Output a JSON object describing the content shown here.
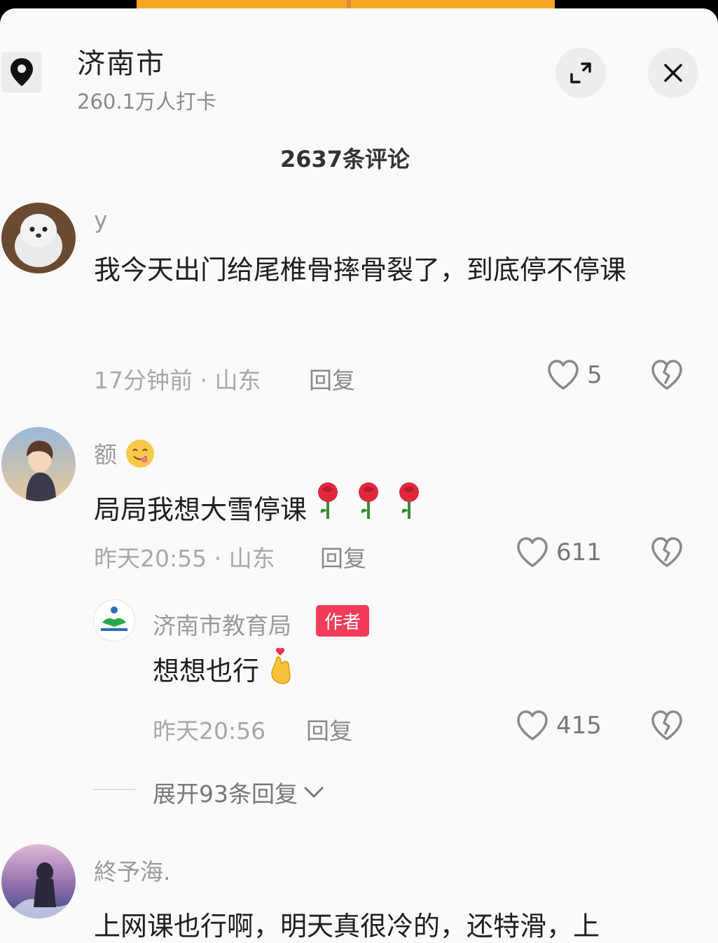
{
  "location": {
    "name": "济南市",
    "checkins": "260.1万人打卡"
  },
  "comment_count": "2637条评论",
  "comments": [
    {
      "username": "y",
      "text": "我今天出门给尾椎骨摔骨裂了，到底停不停课",
      "time_place": "17分钟前 · 山东",
      "reply_label": "回复",
      "likes": "5"
    },
    {
      "username": "额",
      "text": "局局我想大雪停课",
      "time_place": "昨天20:55 · 山东",
      "reply_label": "回复",
      "likes": "611",
      "reply": {
        "username": "济南市教育局",
        "badge": "作者",
        "text": "想想也行",
        "time": "昨天20:56",
        "reply_label": "回复",
        "likes": "415"
      },
      "expand_label": "展开93条回复"
    },
    {
      "username": "終予海.",
      "text": "上网课也行啊，明天真很冷的，还特滑，上"
    }
  ],
  "colors": {
    "badge": "#f23c5a",
    "video_accent": "#f5a623"
  },
  "icons": [
    "location-pin-icon",
    "expand-icon",
    "close-icon",
    "heart-icon",
    "broken-heart-icon",
    "chevron-down-icon"
  ]
}
